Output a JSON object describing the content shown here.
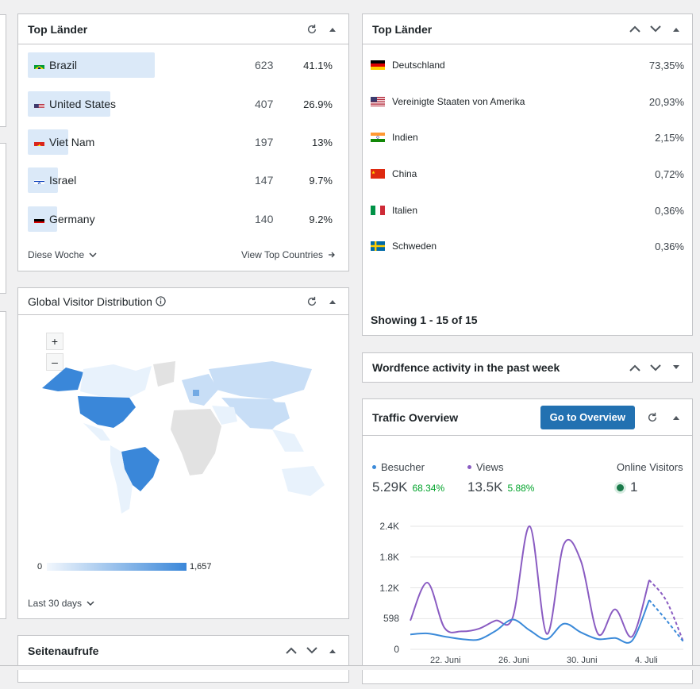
{
  "top_countries_left": {
    "title": "Top Länder",
    "rows": [
      {
        "name": "Brazil",
        "count": "623",
        "pct": "41.1%",
        "flag": "brazil-flag-icon"
      },
      {
        "name": "United States",
        "count": "407",
        "pct": "26.9%",
        "flag": "us-flag-icon"
      },
      {
        "name": "Viet Nam",
        "count": "197",
        "pct": "13%",
        "flag": "vietnam-flag-icon"
      },
      {
        "name": "Israel",
        "count": "147",
        "pct": "9.7%",
        "flag": "israel-flag-icon"
      },
      {
        "name": "Germany",
        "count": "140",
        "pct": "9.2%",
        "flag": "germany-flag-icon"
      }
    ],
    "bar_fractions": [
      1.0,
      0.65,
      0.32,
      0.24,
      0.23
    ],
    "period_label": "Diese Woche",
    "view_link": "View Top Countries"
  },
  "top_countries_right": {
    "title": "Top Länder",
    "rows": [
      {
        "name": "Deutschland",
        "pct": "73,35%",
        "flag": "germany-flag-icon"
      },
      {
        "name": "Vereinigte Staaten von Amerika",
        "pct": "20,93%",
        "flag": "us-flag-icon"
      },
      {
        "name": "Indien",
        "pct": "2,15%",
        "flag": "india-flag-icon"
      },
      {
        "name": "China",
        "pct": "0,72%",
        "flag": "china-flag-icon"
      },
      {
        "name": "Italien",
        "pct": "0,36%",
        "flag": "italy-flag-icon"
      },
      {
        "name": "Schweden",
        "pct": "0,36%",
        "flag": "sweden-flag-icon"
      }
    ],
    "showing": "Showing 1 - 15 of 15"
  },
  "global_distribution": {
    "title": "Global Visitor Distribution",
    "zoom_in": "+",
    "zoom_out": "–",
    "legend_min": "0",
    "legend_max": "1,657",
    "period_label": "Last 30 days"
  },
  "wordfence": {
    "title": "Wordfence activity in the past week"
  },
  "seitenaufrufe": {
    "title": "Seitenaufrufe"
  },
  "traffic": {
    "title": "Traffic Overview",
    "button": "Go to Overview",
    "visitors_label": "Besucher",
    "visitors_value": "5.29K",
    "visitors_change": "68.34%",
    "views_label": "Views",
    "views_value": "13.5K",
    "views_change": "5.88%",
    "online_label": "Online Visitors",
    "online_value": "1",
    "colors": {
      "visitors": "#3b8ad9",
      "views": "#8a5cc2",
      "positive": "#00a32a",
      "accent": "#2271b1"
    }
  },
  "chart_data": {
    "type": "line",
    "y_ticks": [
      "2.4K",
      "1.8K",
      "1.2K",
      "598",
      "0"
    ],
    "x_ticks": [
      "22. Juni",
      "26. Juni",
      "30. Juni",
      "4. Juli"
    ],
    "ylim": [
      0,
      2400
    ],
    "x": [
      "20. Juni",
      "21. Juni",
      "22. Juni",
      "23. Juni",
      "24. Juni",
      "25. Juni",
      "26. Juni",
      "27. Juni",
      "28. Juni",
      "29. Juni",
      "30. Juni",
      "1. Juli",
      "2. Juli",
      "3. Juli",
      "4. Juli",
      "5. Juli",
      "6. Juli"
    ],
    "series": [
      {
        "name": "Views",
        "values": [
          560,
          1300,
          420,
          350,
          400,
          560,
          620,
          2400,
          300,
          2050,
          1720,
          300,
          780,
          250,
          1350,
          950,
          150
        ],
        "color": "#8a5cc2"
      },
      {
        "name": "Besucher",
        "values": [
          290,
          310,
          250,
          200,
          190,
          360,
          580,
          370,
          200,
          500,
          330,
          200,
          220,
          170,
          960,
          570,
          150
        ],
        "color": "#3b8ad9"
      }
    ]
  }
}
